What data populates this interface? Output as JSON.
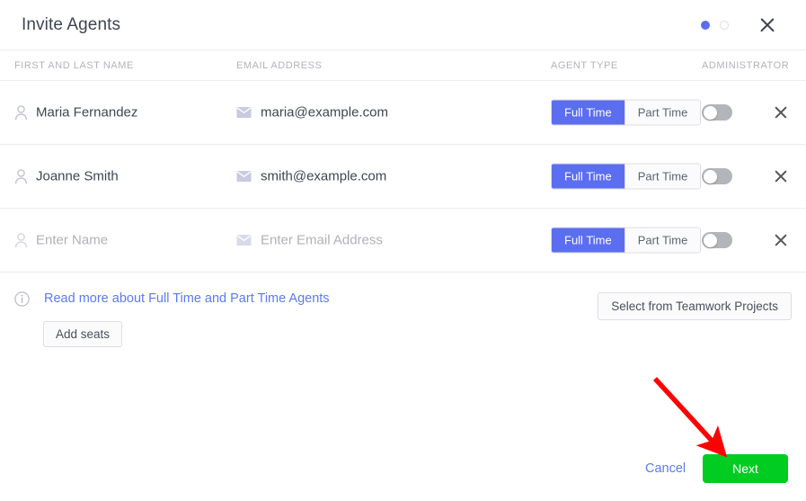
{
  "header": {
    "title": "Invite Agents",
    "close_icon": "close-icon",
    "steps": [
      {
        "state": "active"
      },
      {
        "state": "inactive"
      }
    ]
  },
  "table": {
    "columns": [
      {
        "key": "name",
        "label": "FIRST AND LAST NAME"
      },
      {
        "key": "email",
        "label": "EMAIL ADDRESS"
      },
      {
        "key": "type",
        "label": "AGENT TYPE"
      },
      {
        "key": "admin",
        "label": "ADMINISTRATOR"
      }
    ],
    "agent_type_options": [
      "Full Time",
      "Part Time"
    ],
    "rows": [
      {
        "name": "Maria Fernandez",
        "name_placeholder": "Enter Name",
        "name_is_placeholder": false,
        "email": "maria@example.com",
        "email_placeholder": "Enter Email Address",
        "email_is_placeholder": false,
        "agent_type_selected": "Full Time",
        "administrator": false,
        "name_icon": "person-icon",
        "email_icon": "envelope-icon",
        "remove_icon": "close-icon"
      },
      {
        "name": "Joanne Smith",
        "name_placeholder": "Enter Name",
        "name_is_placeholder": false,
        "email": "smith@example.com",
        "email_placeholder": "Enter Email Address",
        "email_is_placeholder": false,
        "agent_type_selected": "Full Time",
        "administrator": false,
        "name_icon": "person-icon",
        "email_icon": "envelope-icon",
        "remove_icon": "close-icon"
      },
      {
        "name": "Enter Name",
        "name_placeholder": "Enter Name",
        "name_is_placeholder": true,
        "email": "Enter Email Address",
        "email_placeholder": "Enter Email Address",
        "email_is_placeholder": true,
        "agent_type_selected": "Full Time",
        "administrator": false,
        "name_icon": "person-icon",
        "email_icon": "envelope-icon",
        "remove_icon": "close-icon"
      }
    ]
  },
  "info": {
    "icon": "info-circle-icon",
    "link_text": "Read more about Full Time and Part Time Agents",
    "add_seats_label": "Add seats",
    "select_projects_label": "Select from Teamwork Projects"
  },
  "footer": {
    "cancel_label": "Cancel",
    "next_label": "Next"
  },
  "annotation": {
    "arrow_color": "#ff0000",
    "points_to": "next-button"
  },
  "colors": {
    "accent_blue": "#5b6ef0",
    "link_blue": "#5b7bf0",
    "next_green": "#00cc22",
    "border": "#dcdde3",
    "divider": "#ececf0",
    "text_dark": "#3e4552",
    "text_muted": "#b2b3ba",
    "toggle_off": "#b4b5bb"
  }
}
